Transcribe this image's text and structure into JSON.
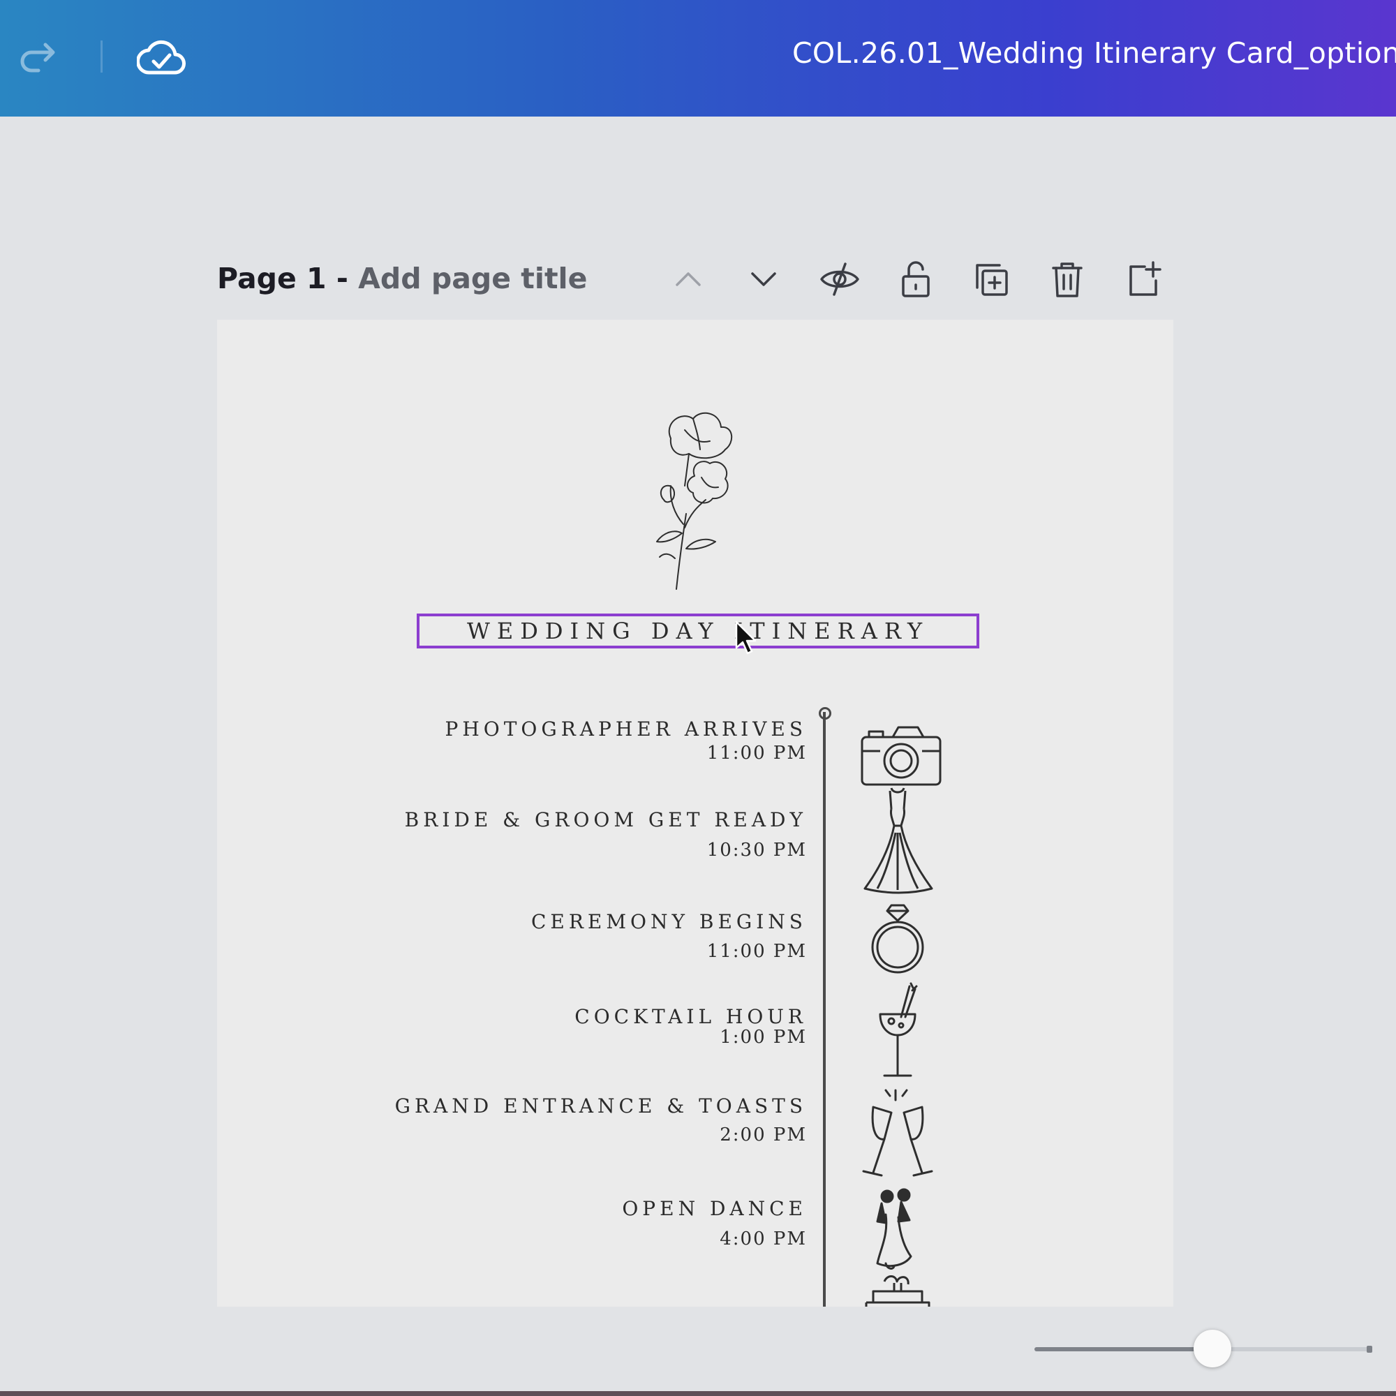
{
  "topbar": {
    "doc_title": "COL.26.01_Wedding Itinerary Card_option(",
    "icons": [
      "redo-icon",
      "cloud-saved-icon"
    ]
  },
  "page_header": {
    "page_number": "Page 1 - ",
    "title_placeholder": "Add page title",
    "tools": [
      "chevron-up-icon",
      "chevron-down-icon",
      "hide-icon",
      "unlock-icon",
      "duplicate-page-icon",
      "trash-icon",
      "add-page-icon"
    ]
  },
  "card": {
    "heading": "WEDDING DAY ITINERARY",
    "events": [
      {
        "title": "PHOTOGRAPHER ARRIVES",
        "time": "11:00 PM",
        "icon": "camera-icon"
      },
      {
        "title": "BRIDE & GROOM GET READY",
        "time": "10:30 PM",
        "icon": "wedding-dress-icon"
      },
      {
        "title": "CEREMONY BEGINS",
        "time": "11:00 PM",
        "icon": "ring-icon"
      },
      {
        "title": "COCKTAIL HOUR",
        "time": "1:00 PM",
        "icon": "cocktail-icon"
      },
      {
        "title": "GRAND ENTRANCE & TOASTS",
        "time": "2:00 PM",
        "icon": "champagne-toast-icon"
      },
      {
        "title": "OPEN DANCE",
        "time": "4:00 PM",
        "icon": "dancing-couple-icon"
      }
    ]
  },
  "zoom": {
    "level": 0.53
  },
  "colors": {
    "selection": "#8c3ecf",
    "topbar_start": "#2a86c2",
    "topbar_end": "#5a36cf"
  }
}
